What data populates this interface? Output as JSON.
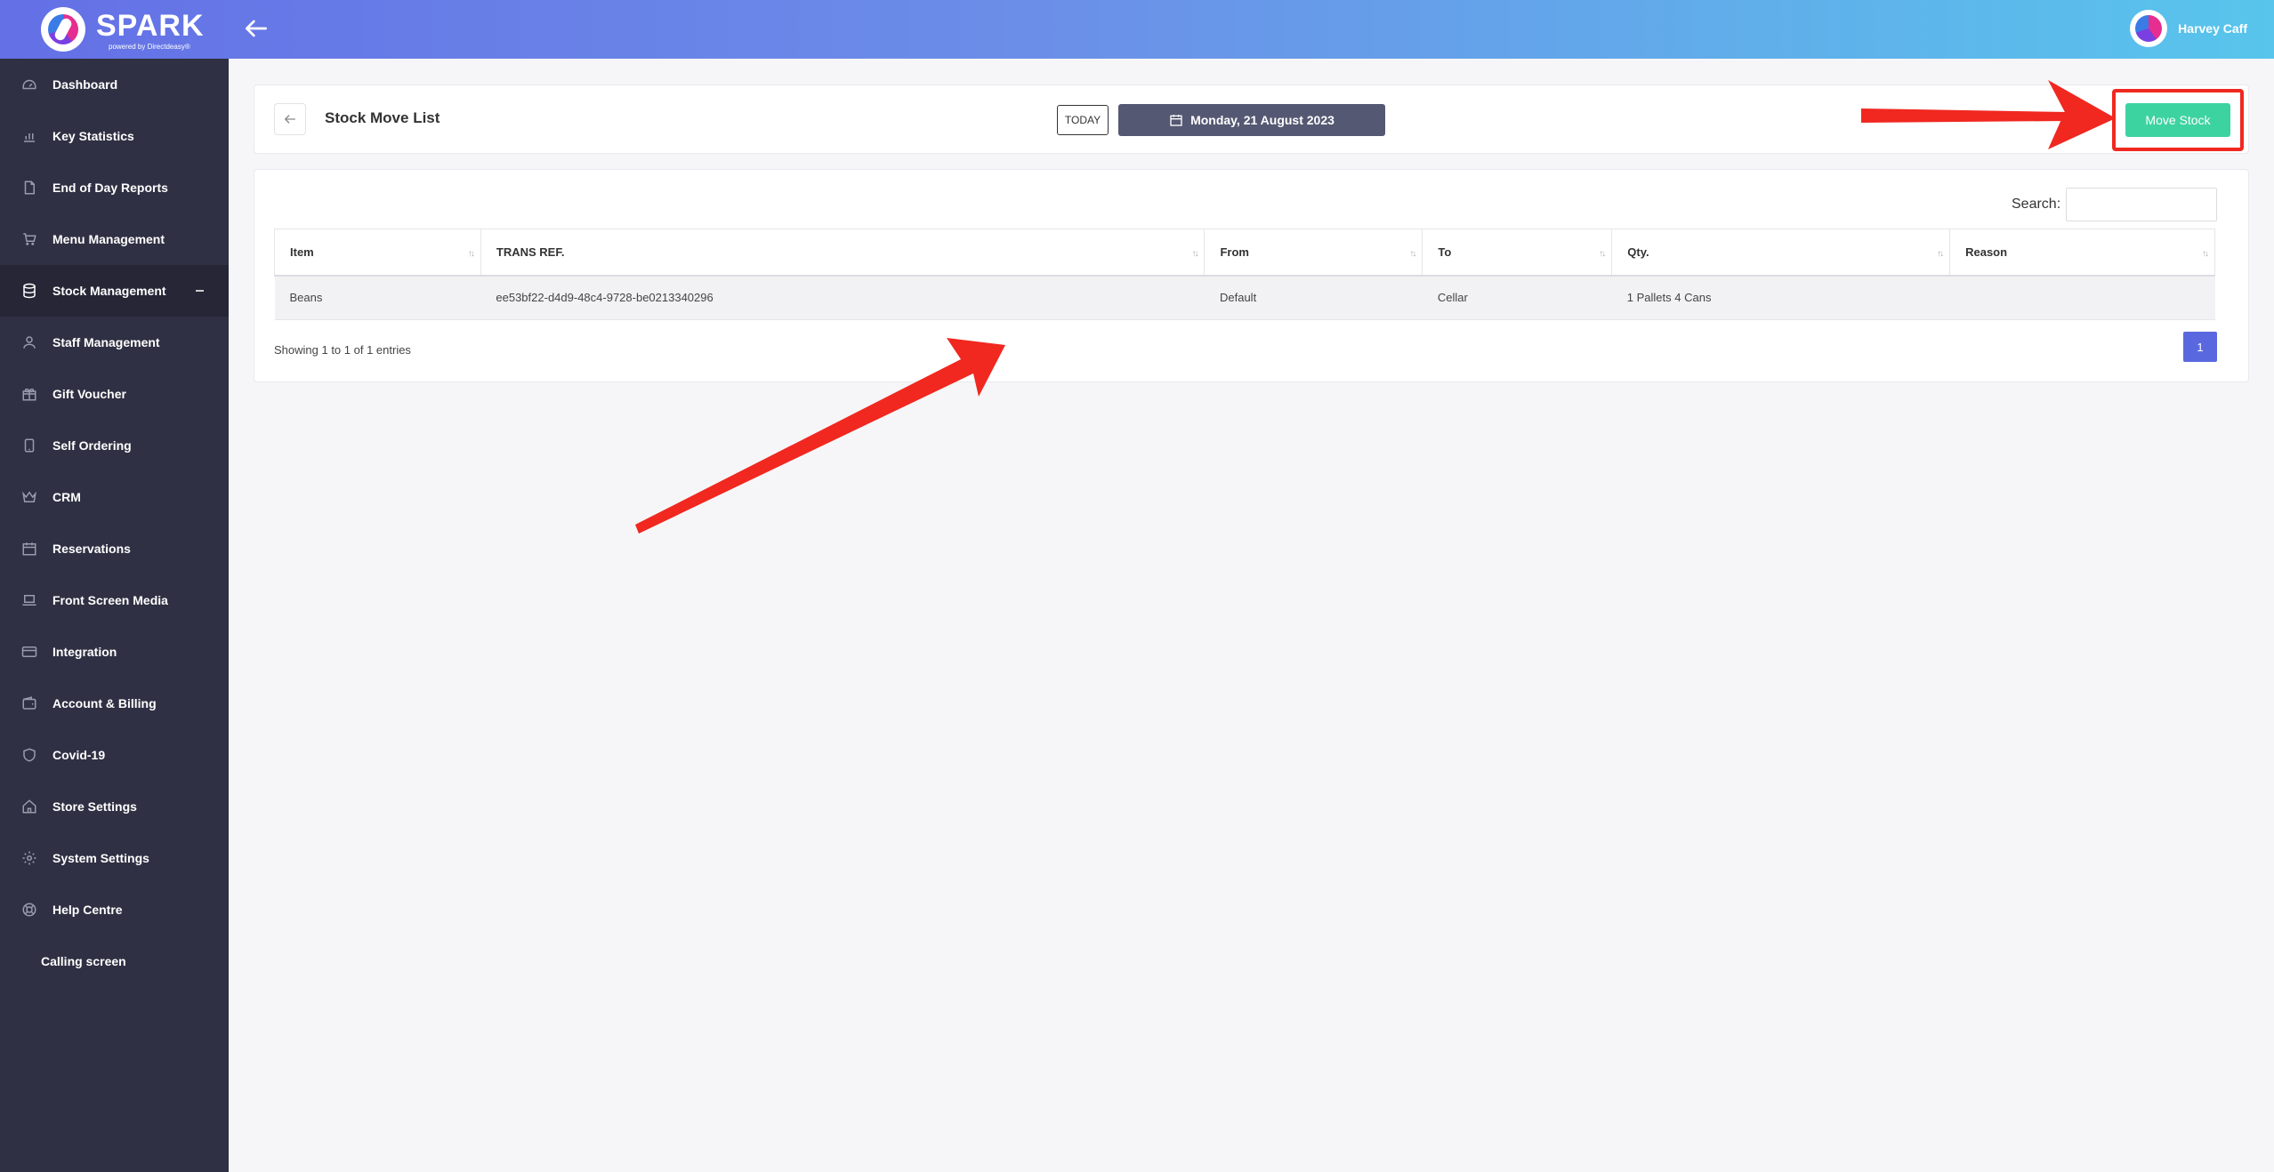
{
  "brand": {
    "name": "SPARK",
    "tagline": "powered by Directdeasy®"
  },
  "user": {
    "name": "Harvey Caff"
  },
  "sidebar": {
    "items": [
      {
        "label": "Dashboard",
        "icon": "dashboard-icon"
      },
      {
        "label": "Key Statistics",
        "icon": "bar-chart-icon"
      },
      {
        "label": "End of Day Reports",
        "icon": "report-icon"
      },
      {
        "label": "Menu Management",
        "icon": "cart-icon"
      },
      {
        "label": "Stock Management",
        "icon": "database-icon",
        "active": true
      },
      {
        "label": "Staff Management",
        "icon": "user-icon"
      },
      {
        "label": "Gift Voucher",
        "icon": "gift-icon"
      },
      {
        "label": "Self Ordering",
        "icon": "tablet-icon"
      },
      {
        "label": "CRM",
        "icon": "crown-icon"
      },
      {
        "label": "Reservations",
        "icon": "calendar-icon"
      },
      {
        "label": "Front Screen Media",
        "icon": "laptop-icon"
      },
      {
        "label": "Integration",
        "icon": "card-icon"
      },
      {
        "label": "Account & Billing",
        "icon": "wallet-icon"
      },
      {
        "label": "Covid-19",
        "icon": "shield-icon"
      },
      {
        "label": "Store Settings",
        "icon": "home-icon"
      },
      {
        "label": "System Settings",
        "icon": "gear-icon"
      },
      {
        "label": "Help Centre",
        "icon": "lifebuoy-icon"
      },
      {
        "label": "Calling screen",
        "icon": ""
      }
    ]
  },
  "header": {
    "title": "Stock Move List",
    "today_label": "TODAY",
    "date_label": "Monday, 21 August 2023",
    "move_stock_label": "Move Stock"
  },
  "table": {
    "search_label": "Search:",
    "search_value": "",
    "columns": [
      "Item",
      "TRANS REF.",
      "From",
      "To",
      "Qty.",
      "Reason"
    ],
    "rows": [
      [
        "Beans",
        "ee53bf22-d4d9-48c4-9728-be0213340296",
        "Default",
        "Cellar",
        "1 Pallets 4 Cans",
        ""
      ]
    ],
    "info": "Showing 1 to 1 of 1 entries",
    "page": "1"
  },
  "colors": {
    "accent": "#5a68e0",
    "sidebar_bg": "#2f3043",
    "move_stock_button": "#3dd3a1",
    "annotation_red": "#f02820"
  }
}
